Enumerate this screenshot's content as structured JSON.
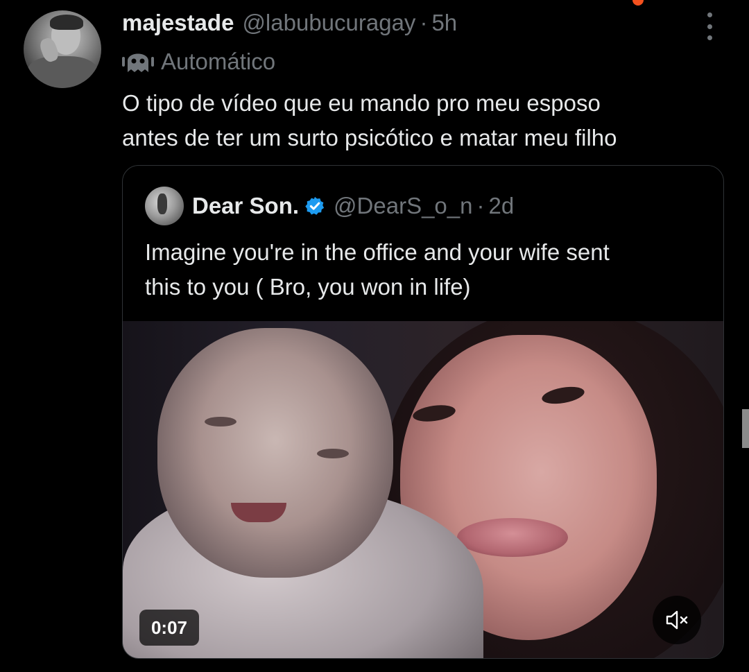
{
  "tweet": {
    "display_name": "majestade",
    "handle": "@labubucuragay",
    "separator": "·",
    "time": "5h",
    "automated_label": "Automático",
    "text_line1": "O tipo de vídeo que eu mando pro meu esposo",
    "text_line2": "antes de ter um surto psicótico e matar meu filho"
  },
  "quoted_tweet": {
    "display_name": "Dear Son.",
    "handle": "@DearS_o_n",
    "separator": "·",
    "time": "2d",
    "verified": true,
    "text_line1": "Imagine you're in the office and your wife sent",
    "text_line2": "this to you ( Bro, you won in life)",
    "media": {
      "type": "video",
      "duration_label": "0:07",
      "muted": true
    }
  },
  "icons": {
    "more": "more-vertical-icon",
    "automated": "bot-icon",
    "verified": "verified-badge-icon",
    "mute": "volume-muted-icon"
  },
  "colors": {
    "background": "#000000",
    "text": "#e7e9ea",
    "secondary_text": "#71767b",
    "verified_blue": "#1d9bf0",
    "border": "#2f3336"
  }
}
